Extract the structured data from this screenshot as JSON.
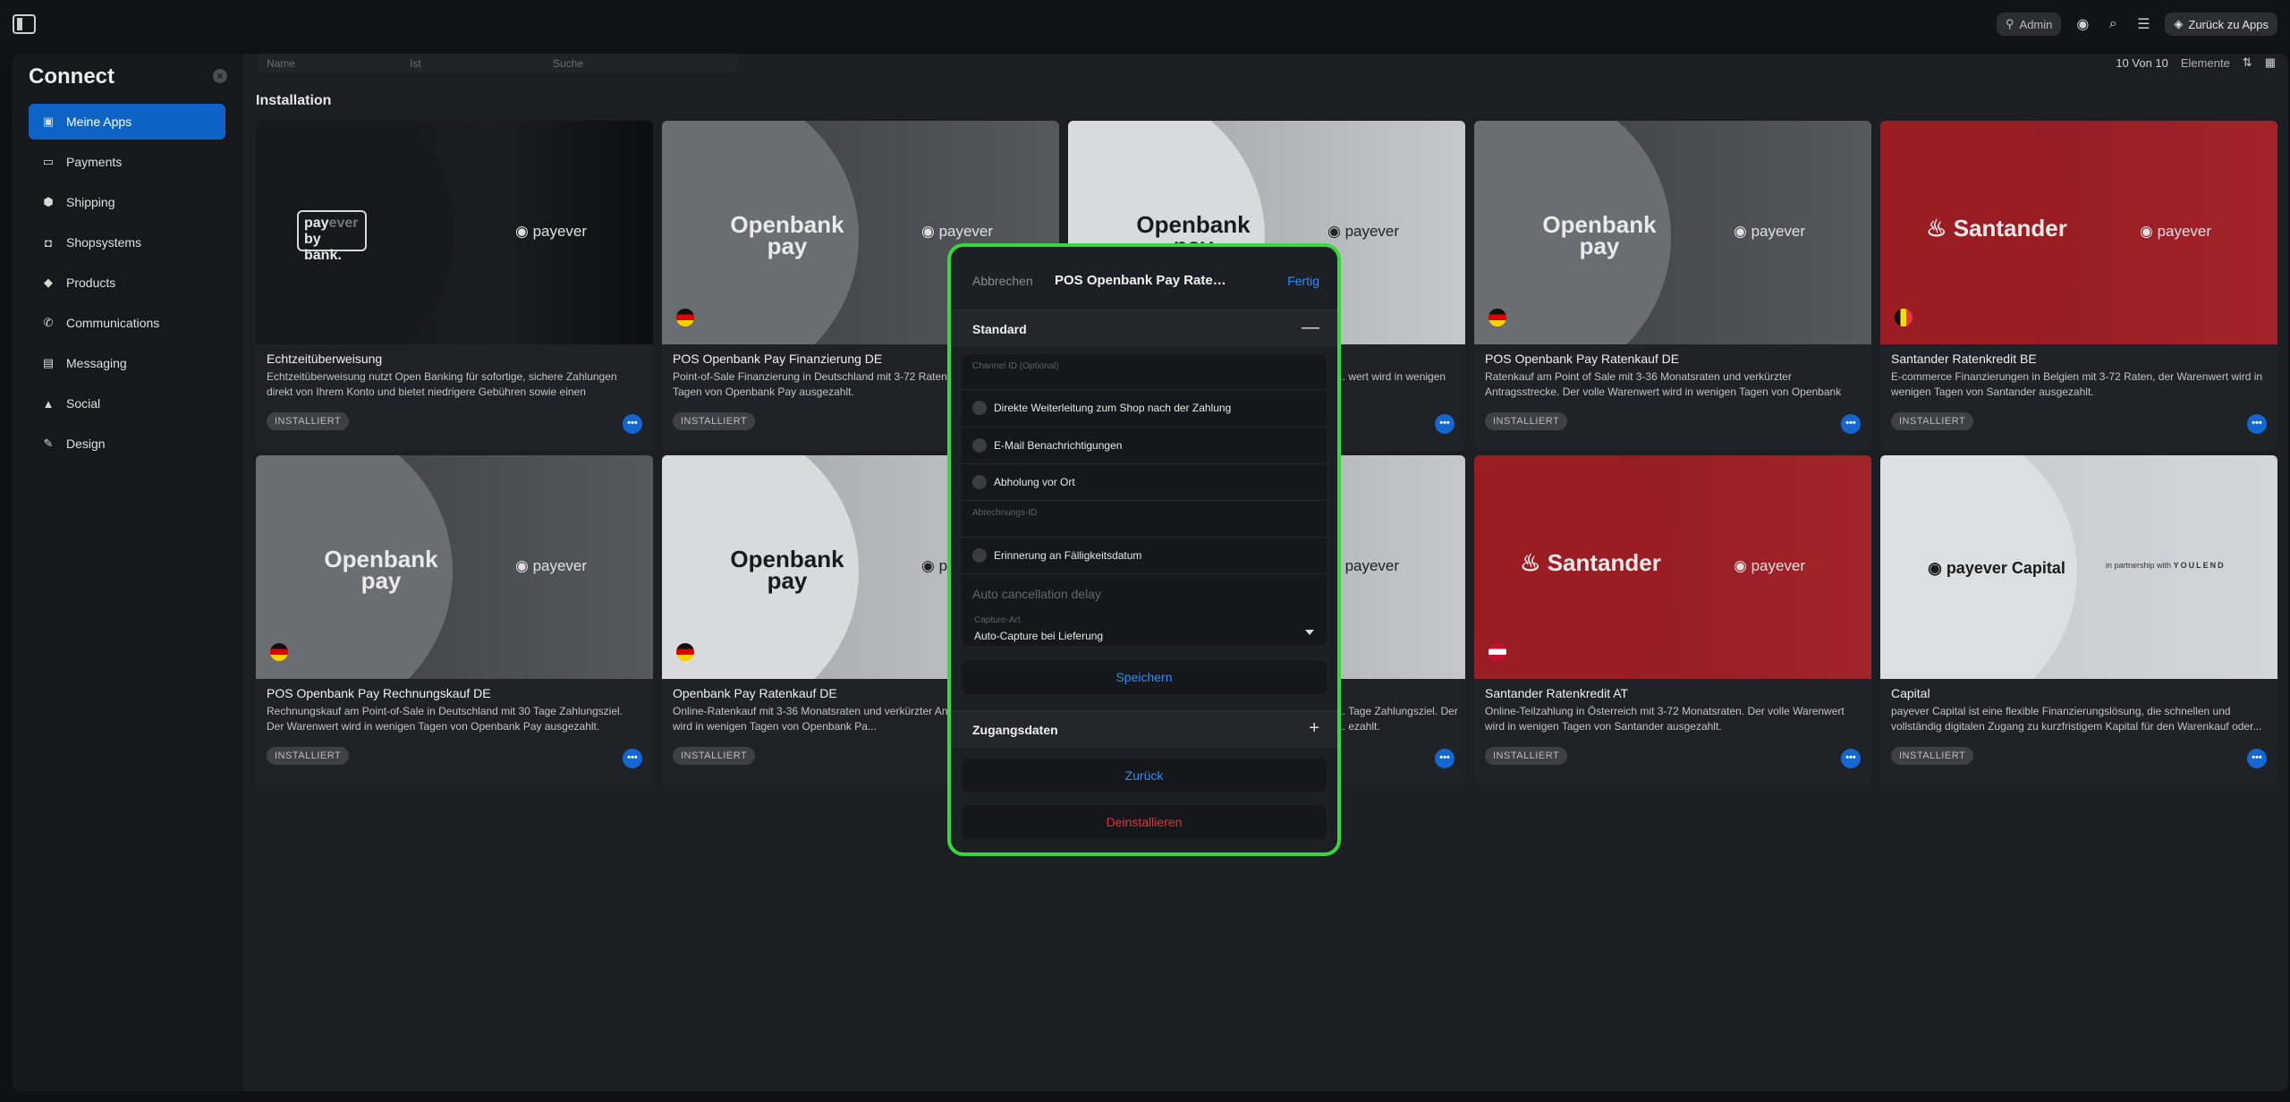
{
  "topbar": {
    "admin_label": "Admin",
    "back_label": "Zurück zu Apps"
  },
  "sidebar": {
    "title": "Connect",
    "items": [
      {
        "label": "Meine Apps",
        "icon": "apps-icon",
        "active": true
      },
      {
        "label": "Payments",
        "icon": "card-icon"
      },
      {
        "label": "Shipping",
        "icon": "box-icon"
      },
      {
        "label": "Shopsystems",
        "icon": "bag-icon"
      },
      {
        "label": "Products",
        "icon": "tag-icon"
      },
      {
        "label": "Communications",
        "icon": "phone-icon"
      },
      {
        "label": "Messaging",
        "icon": "chat-icon"
      },
      {
        "label": "Social",
        "icon": "thumb-icon"
      },
      {
        "label": "Design",
        "icon": "brush-icon"
      }
    ]
  },
  "filters": {
    "name": "Name",
    "ist": "Ist",
    "search": "Suche"
  },
  "counter": {
    "count": "10 Von 10",
    "unit": "Elemente"
  },
  "section_title": "Installation",
  "cards": [
    {
      "title": "Echtzeitüberweisung",
      "desc": "Echtzeitüberweisung nutzt Open Banking für sofortige, sichere Zahlungen direkt von Ihrem Konto und bietet niedrigere Gebühren sowie einen schnellere...",
      "badge": "INSTALLIERT",
      "logo_line1": "pay",
      "logo_line1b": "ever",
      "logo_line2": "by bank.",
      "brand": "payever"
    },
    {
      "title": "POS Openbank Pay Finanzierung DE",
      "desc": "Point-of-Sale Finanzierung in Deutschland mit 3-72 Raten, ... in wenigen Tagen von Openbank Pay ausgezahlt.",
      "badge": "INSTALLIERT",
      "logo_line1": "Openbank",
      "logo_line2": "pay",
      "brand": "payever"
    },
    {
      "title": "",
      "desc": "... wert wird in wenigen",
      "badge": "INSTALLIERT",
      "logo_line1": "Openbank",
      "logo_line2": "pay",
      "brand": "payever"
    },
    {
      "title": "POS Openbank Pay Ratenkauf DE",
      "desc": "Ratenkauf am Point of Sale mit 3-36 Monatsraten und verkürzter Antragsstrecke. Der volle Warenwert wird in wenigen Tagen von Openbank Pa...",
      "badge": "INSTALLIERT",
      "logo_line1": "Openbank",
      "logo_line2": "pay",
      "brand": "payever"
    },
    {
      "title": "Santander Ratenkredit BE",
      "desc": "E-commerce Finanzierungen in Belgien mit 3-72 Raten, der Warenwert wird in wenigen Tagen von Santander ausgezahlt.",
      "badge": "INSTALLIERT",
      "logo_line1": "Santander",
      "brand": "payever"
    },
    {
      "title": "POS Openbank Pay Rechnungskauf DE",
      "desc": "Rechnungskauf am Point-of-Sale in Deutschland mit 30 Tage Zahlungsziel. Der Warenwert wird in wenigen Tagen von Openbank Pay ausgezahlt.",
      "badge": "INSTALLIERT",
      "logo_line1": "Openbank",
      "logo_line2": "pay",
      "brand": "payever"
    },
    {
      "title": "Openbank Pay Ratenkauf DE",
      "desc": "Online-Ratenkauf mit 3-36 Monatsraten und verkürzter An... volle Warenwert wird in wenigen Tagen von Openbank Pa...",
      "badge": "INSTALLIERT",
      "logo_line1": "Openbank",
      "logo_line2": "pay",
      "brand": "payever"
    },
    {
      "title": "",
      "desc": "... Tage Zahlungsziel. Der ... ezahlt.",
      "badge": "INSTALLIERT",
      "logo_line1": "",
      "brand": "payever"
    },
    {
      "title": "Santander Ratenkredit AT",
      "desc": "Online-Teilzahlung in Österreich mit 3-72 Monatsraten. Der volle Warenwert wird in wenigen Tagen von Santander ausgezahlt.",
      "badge": "INSTALLIERT",
      "logo_line1": "Santander",
      "brand": "payever"
    },
    {
      "title": "Capital",
      "desc": "payever Capital ist eine flexible Finanzierungslösung, die schnellen und vollständig digitalen Zugang zu kurzfristigem Kapital für den Warenkauf oder...",
      "badge": "INSTALLIERT",
      "logo_line1": "payever Capital",
      "partner": "in partnership with",
      "partner_brand": "YOULEND"
    }
  ],
  "modal": {
    "cancel": "Abbrechen",
    "title": "POS Openbank Pay Ratenk...",
    "done": "Fertig",
    "section_standard": "Standard",
    "channel_placeholder": "Channel ID (Optional)",
    "opt_redirect": "Direkte Weiterleitung zum Shop nach der Zahlung",
    "opt_email": "E-Mail Benachrichtigungen",
    "opt_pickup": "Abholung vor Ort",
    "billing_placeholder": "Abrechnungs-ID",
    "opt_reminder": "Erinnerung an Fälligkeitsdatum",
    "auto_cancel_placeholder": "Auto cancellation delay",
    "capture_label": "Capture-Art",
    "capture_value": "Auto-Capture bei Lieferung",
    "save": "Speichern",
    "section_credentials": "Zugangsdaten",
    "back": "Zurück",
    "uninstall": "Deinstallieren"
  }
}
